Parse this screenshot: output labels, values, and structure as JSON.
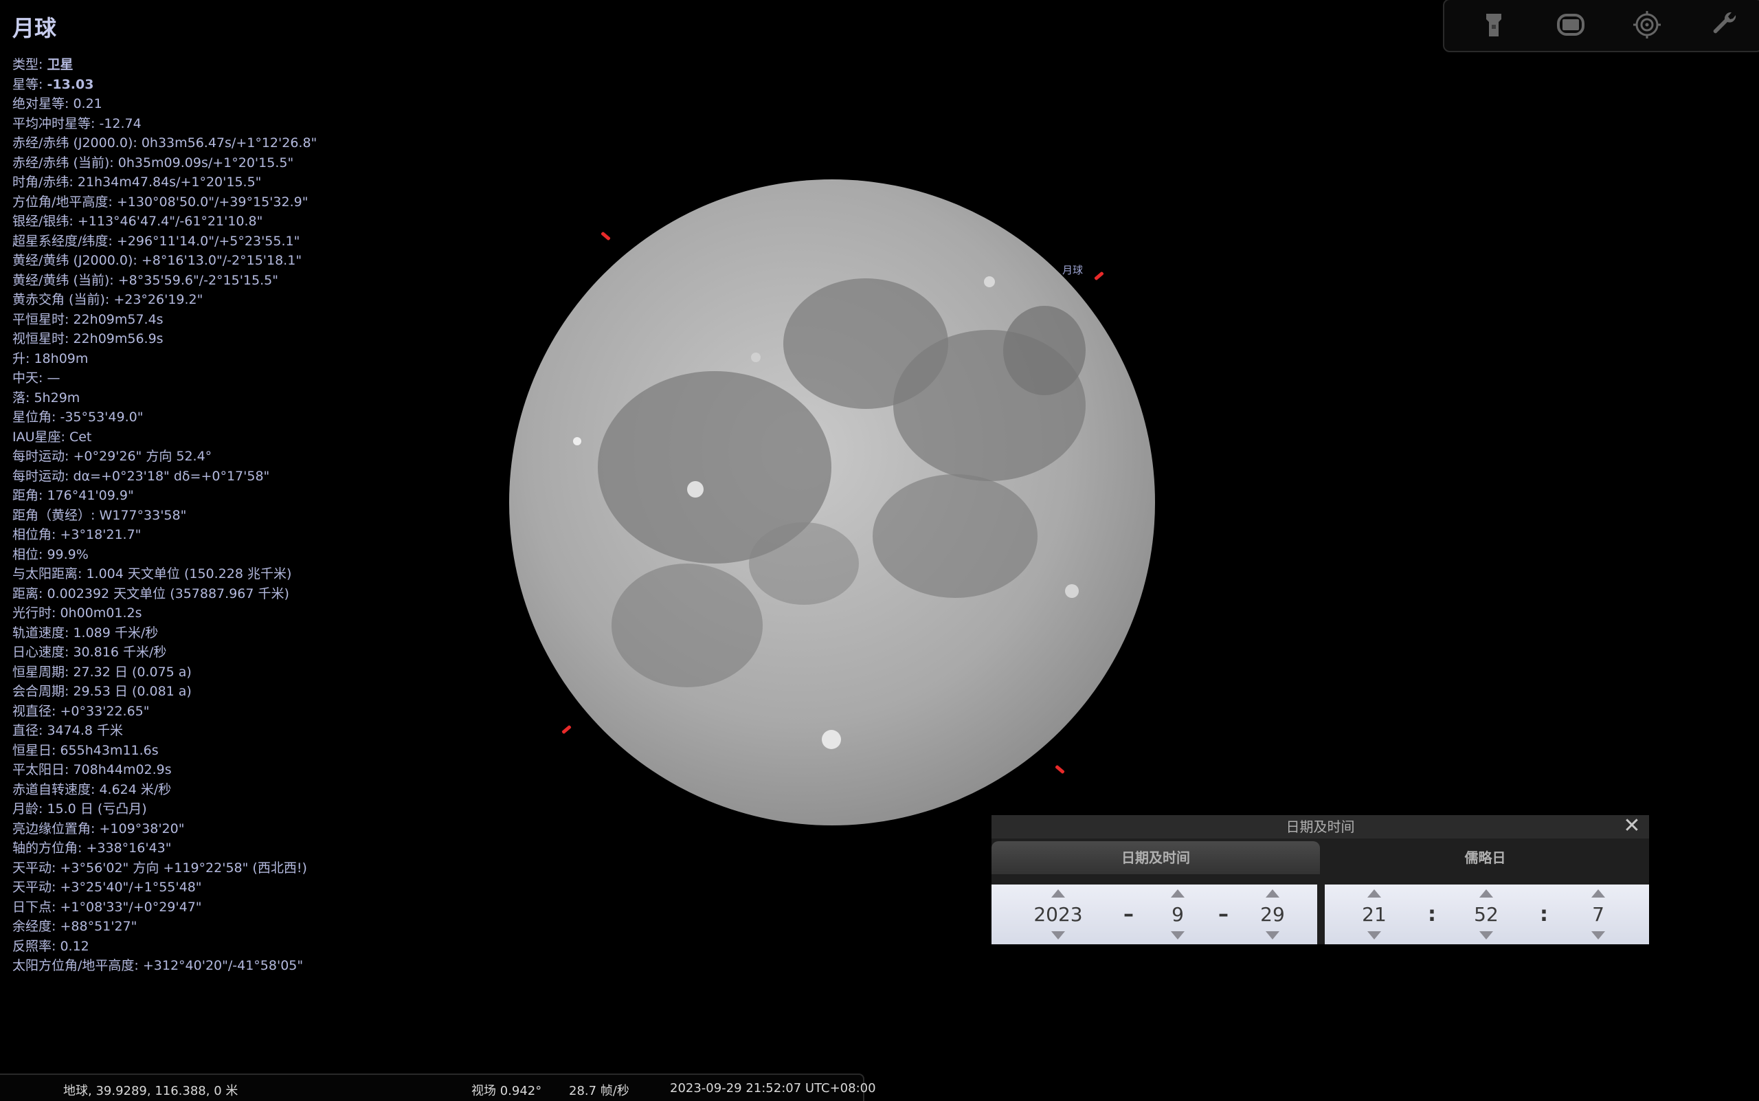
{
  "object": {
    "title": "月球",
    "info_lines": [
      {
        "label": "类型",
        "value": "卫星",
        "bold": true
      },
      {
        "label": "星等",
        "value": "-13.03",
        "bold": true
      },
      {
        "label": "绝对星等",
        "value": "0.21"
      },
      {
        "label": "平均冲时星等",
        "value": "-12.74"
      },
      {
        "label": "赤经/赤纬 (J2000.0)",
        "value": "0h33m56.47s/+1°12'26.8\""
      },
      {
        "label": "赤经/赤纬 (当前)",
        "value": "0h35m09.09s/+1°20'15.5\""
      },
      {
        "label": "时角/赤纬",
        "value": "21h34m47.84s/+1°20'15.5\""
      },
      {
        "label": "方位角/地平高度",
        "value": "+130°08'50.0\"/+39°15'32.9\""
      },
      {
        "label": "银经/银纬",
        "value": "+113°46'47.4\"/-61°21'10.8\""
      },
      {
        "label": "超星系经度/纬度",
        "value": "+296°11'14.0\"/+5°23'55.1\""
      },
      {
        "label": "黄经/黄纬 (J2000.0)",
        "value": "+8°16'13.0\"/-2°15'18.1\""
      },
      {
        "label": "黄经/黄纬 (当前)",
        "value": "+8°35'59.6\"/-2°15'15.5\""
      },
      {
        "label": "黄赤交角 (当前)",
        "value": "+23°26'19.2\""
      },
      {
        "label": "平恒星时",
        "value": "22h09m57.4s"
      },
      {
        "label": "视恒星时",
        "value": "22h09m56.9s"
      },
      {
        "label": "升",
        "value": "18h09m"
      },
      {
        "label": "中天",
        "value": "—"
      },
      {
        "label": "落",
        "value": "5h29m"
      },
      {
        "label": "星位角",
        "value": "-35°53'49.0\""
      },
      {
        "label": "IAU星座",
        "value": "Cet"
      },
      {
        "label": "每时运动",
        "value": "+0°29'26\" 方向 52.4°"
      },
      {
        "label": "每时运动",
        "value": "dα=+0°23'18\" dδ=+0°17'58\""
      },
      {
        "label": "距角",
        "value": "176°41'09.9\""
      },
      {
        "label": "距角（黄经）",
        "value": "W177°33'58\""
      },
      {
        "label": "相位角",
        "value": "+3°18'21.7\""
      },
      {
        "label": "相位",
        "value": "99.9%"
      },
      {
        "label": "与太阳距离",
        "value": "1.004 天文单位 (150.228 兆千米)"
      },
      {
        "label": "距离",
        "value": "0.002392 天文单位 (357887.967 千米)"
      },
      {
        "label": "光行时",
        "value": "0h00m01.2s"
      },
      {
        "label": "轨道速度",
        "value": "1.089 千米/秒"
      },
      {
        "label": "日心速度",
        "value": "30.816 千米/秒"
      },
      {
        "label": "恒星周期",
        "value": "27.32 日 (0.075 a)"
      },
      {
        "label": "会合周期",
        "value": "29.53 日 (0.081 a)"
      },
      {
        "label": "视直径",
        "value": "+0°33'22.65\""
      },
      {
        "label": "直径",
        "value": "3474.8 千米"
      },
      {
        "label": "恒星日",
        "value": "655h43m11.6s"
      },
      {
        "label": "平太阳日",
        "value": "708h44m02.9s"
      },
      {
        "label": "赤道自转速度",
        "value": "4.624 米/秒"
      },
      {
        "label": "月龄",
        "value": "15.0 日 (亏凸月)"
      },
      {
        "label": "亮边缘位置角",
        "value": "+109°38'20\""
      },
      {
        "label": "轴的方位角",
        "value": "+338°16'43\""
      },
      {
        "label": "天平动",
        "value": "+3°56'02\" 方向 +119°22'58\" (西北西!)"
      },
      {
        "label": "天平动",
        "value": "+3°25'40\"/+1°55'48\""
      },
      {
        "label": "日下点",
        "value": "+1°08'33\"/+0°29'47\""
      },
      {
        "label": "余经度",
        "value": "+88°51'27\""
      },
      {
        "label": "反照率",
        "value": "0.12"
      },
      {
        "label": "太阳方位角/地平高度",
        "value": "+312°40'20\"/-41°58'05\""
      }
    ],
    "map_label": "月球"
  },
  "toolbar": {
    "icons": [
      "flashlight-icon",
      "screen-icon",
      "target-icon",
      "wrench-icon"
    ]
  },
  "datetime_dialog": {
    "title": "日期及时间",
    "tabs": [
      "日期及时间",
      "儒略日"
    ],
    "date": {
      "year": "2023",
      "month": "9",
      "day": "29",
      "sep": "–"
    },
    "time": {
      "hour": "21",
      "minute": "52",
      "second": "7",
      "sep": ":"
    }
  },
  "statusbar": {
    "location": "地球, 39.9289, 116.388, 0 米",
    "fov": "视场 0.942°",
    "fps": "28.7 帧/秒",
    "datetime": "2023-09-29 21:52:07 UTC+08:00"
  },
  "colors": {
    "marker": "#e82a2a",
    "info_text": "#b4badf"
  }
}
